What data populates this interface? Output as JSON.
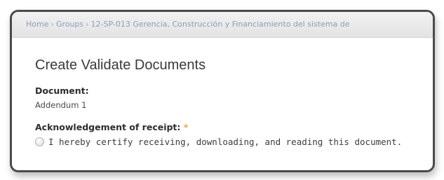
{
  "breadcrumb": {
    "items": [
      "Home",
      "Groups",
      "12-SP-013 Gerencia, Construcción y Financiamiento del sistema de"
    ],
    "separator": "›"
  },
  "page": {
    "title": "Create Validate Documents"
  },
  "document": {
    "label": "Document:",
    "value": "Addendum 1"
  },
  "acknowledgement": {
    "label": "Acknowledgement of receipt:",
    "required_mark": "*",
    "option_text": "I hereby certify receiving, downloading, and reading this document."
  }
}
